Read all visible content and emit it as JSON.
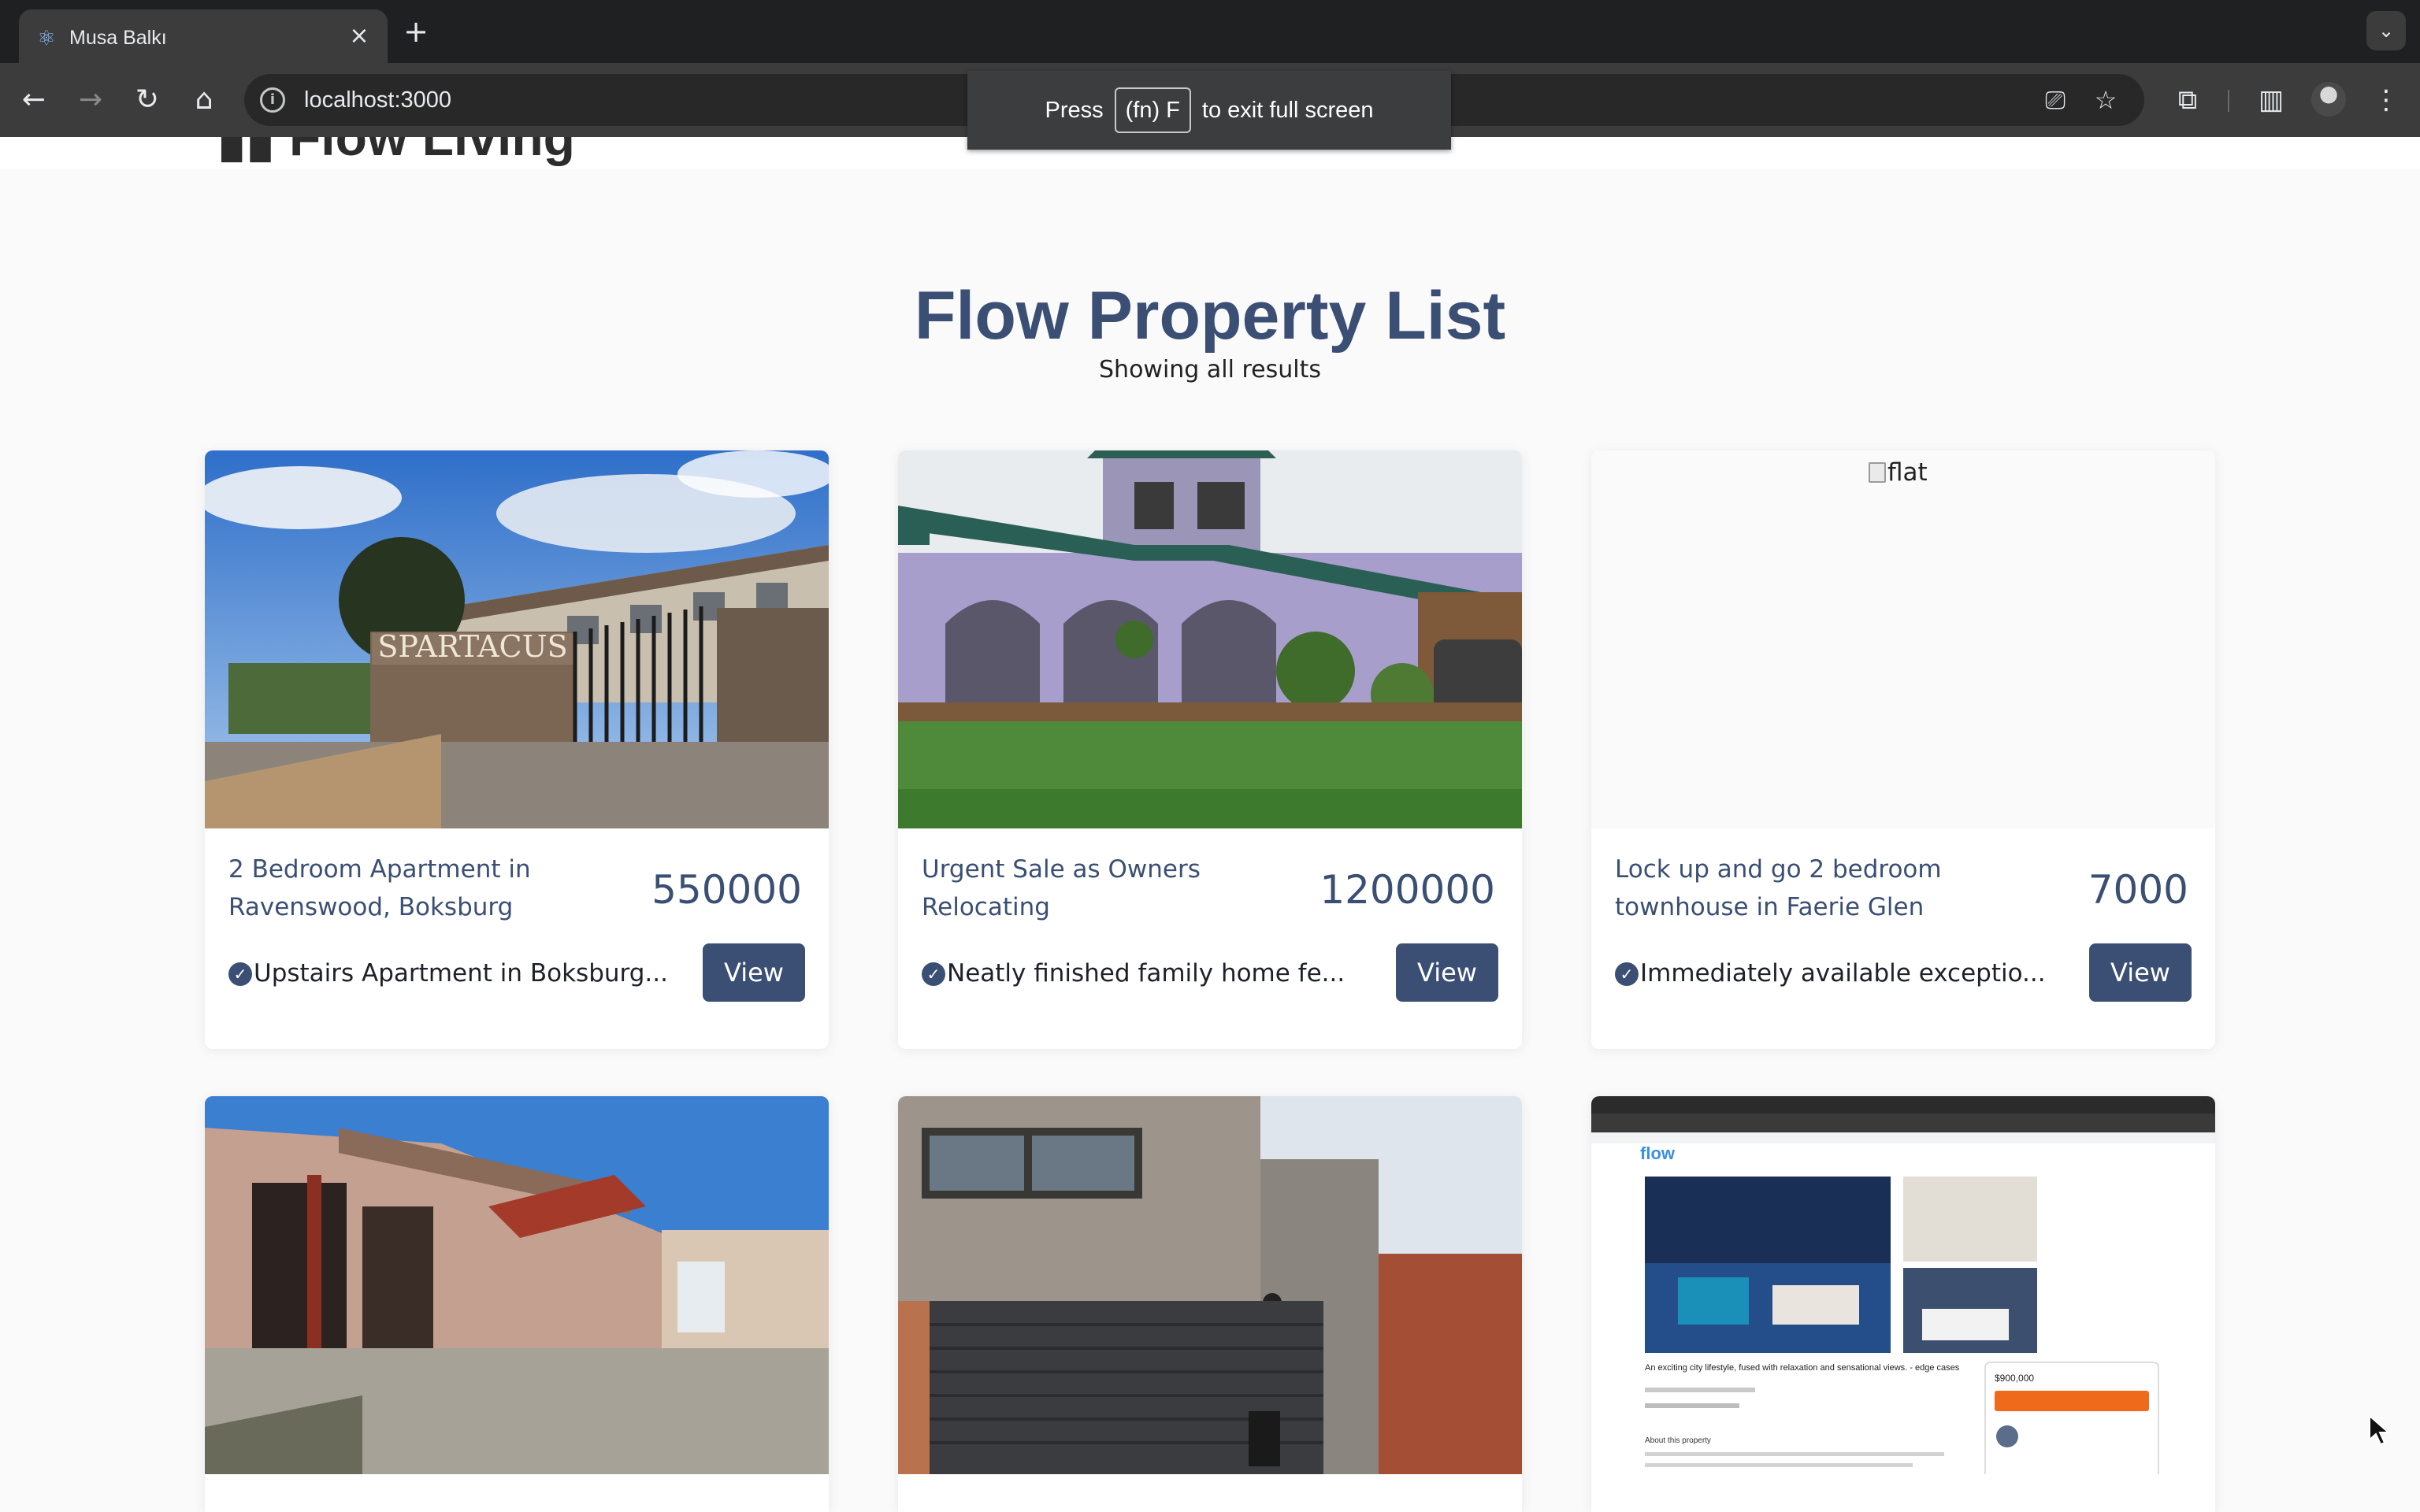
{
  "browser": {
    "tab_title": "Musa Balkı",
    "tab_favicon": "react-atom-icon",
    "url": "localhost:3000",
    "fullscreen_toast": {
      "prefix": "Press",
      "key": "(fn) F",
      "suffix": "to exit full screen"
    }
  },
  "page": {
    "title": "Flow Property List",
    "subtitle": "Showing all results"
  },
  "properties": [
    {
      "title": "2 Bedroom Apartment in Ravenswood, Boksburg",
      "price": "550000",
      "description": "Upstairs Apartment in Boksburg...",
      "button": "View",
      "image_text": "SPARTACUS"
    },
    {
      "title": "Urgent Sale as Owners Relocating",
      "price": "1200000",
      "description": "Neatly finished family home fe...",
      "button": "View"
    },
    {
      "title": "Lock up and go 2 bedroom townhouse in Faerie Glen",
      "price": "7000",
      "description": "Immediately available exceptio...",
      "button": "View",
      "image_alt": "flat"
    },
    {
      "title": "",
      "price": "",
      "description": "",
      "button": ""
    },
    {
      "title": "",
      "price": "",
      "description": "",
      "button": ""
    },
    {
      "title": "",
      "price": "",
      "description": "",
      "button": "",
      "image_text": {
        "brand": "flow",
        "headline": "An exciting city lifestyle, fused with relaxation and sensational views. - edge cases",
        "price": "$900,000",
        "section": "About this property"
      }
    }
  ]
}
